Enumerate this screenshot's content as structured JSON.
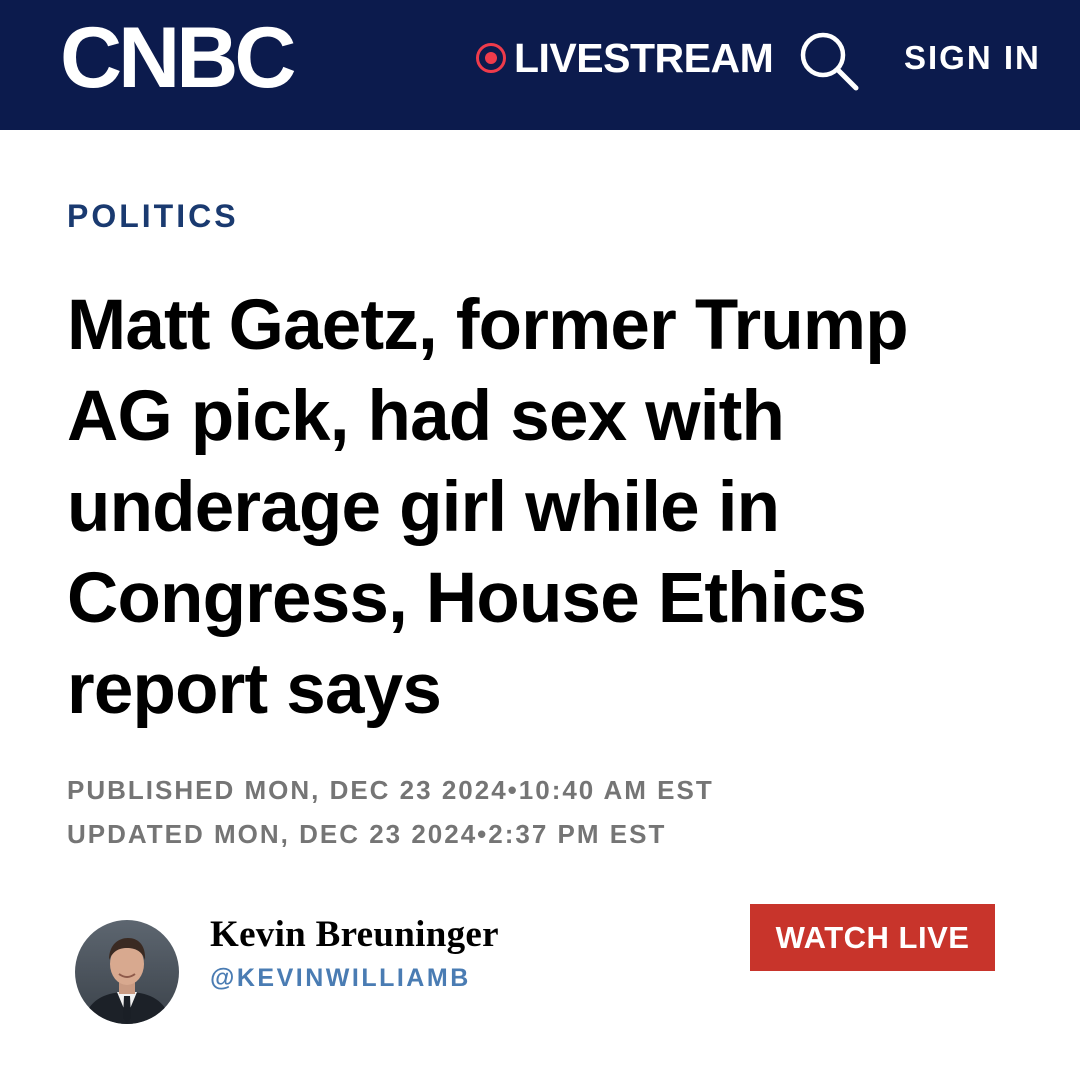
{
  "header": {
    "logo_text": "CNBC",
    "livestream_label": "LIVESTREAM",
    "search_icon": "search-icon",
    "sign_in_label": "SIGN IN",
    "colors": {
      "background": "#0c1b4d",
      "live_dot": "#ef3b4b"
    }
  },
  "article": {
    "section": "POLITICS",
    "headline": "Matt Gaetz, former Trump AG pick, had sex with underage girl while in Congress, House Ethics report says",
    "published": "PUBLISHED MON, DEC 23 2024•10:40 AM EST",
    "updated": "UPDATED MON, DEC 23 2024•2:37 PM EST"
  },
  "author": {
    "name": "Kevin Breuninger",
    "handle": "@KEVINWILLIAMB"
  },
  "watch_live": {
    "label": "WATCH LIVE",
    "color": "#c8342b"
  }
}
